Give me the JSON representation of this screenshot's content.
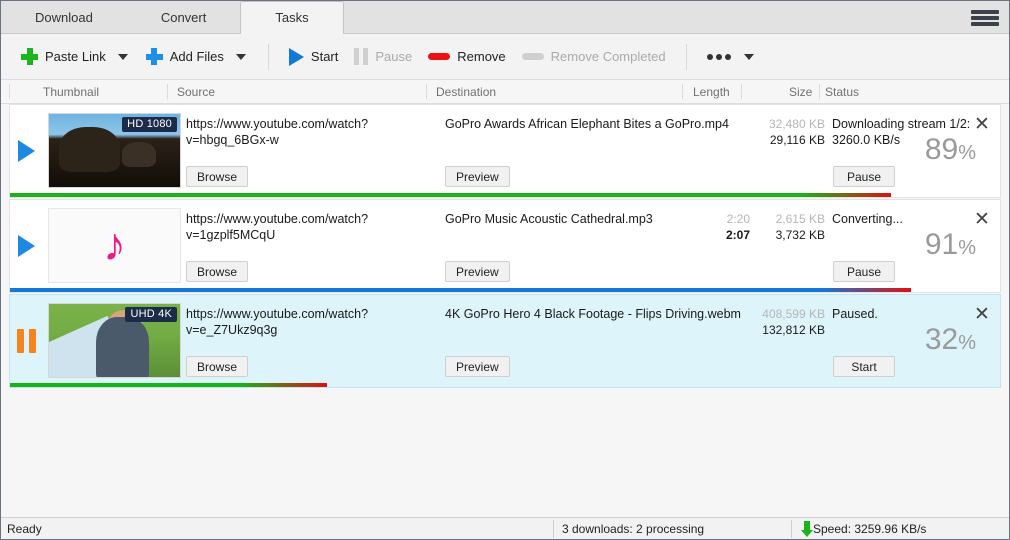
{
  "window": {
    "tabs": [
      {
        "label": "Download",
        "active": false
      },
      {
        "label": "Convert",
        "active": false
      },
      {
        "label": "Tasks",
        "active": true
      }
    ],
    "menu_icon": "hamburger-menu-icon"
  },
  "toolbar": {
    "paste_link": "Paste Link",
    "add_files": "Add Files",
    "start": "Start",
    "pause": "Pause",
    "remove": "Remove",
    "remove_completed": "Remove Completed",
    "more": "more-options-icon",
    "colors": {
      "paste_plus": "#1cb61c",
      "add_plus": "#1e90e8",
      "start_play": "#1479d6",
      "remove_bar": "#ee1111",
      "disabled": "#cfcfcf"
    }
  },
  "columns": {
    "thumbnail": "Thumbnail",
    "source": "Source",
    "destination": "Destination",
    "length": "Length",
    "size": "Size",
    "status": "Status"
  },
  "rows": [
    {
      "state_icon": "play-icon",
      "selected": false,
      "thumbnail": {
        "kind": "video",
        "art": "art-eleph",
        "badge": "HD 1080"
      },
      "source": "https://www.youtube.com/watch?v=hbgq_6BGx-w",
      "destination": "GoPro Awards  African Elephant Bites a GoPro.mp4",
      "length_total": "",
      "length_current": "",
      "size_total": "32,480 KB",
      "size_current": "29,116 KB",
      "status_line1": "Downloading stream 1/2:",
      "status_line2": "3260.0 KB/s",
      "percent": 89,
      "percent_label": "89",
      "browse": "Browse",
      "preview": "Preview",
      "action": "Pause",
      "close": "close-icon",
      "bar_color": "#18b318"
    },
    {
      "state_icon": "play-icon",
      "selected": false,
      "thumbnail": {
        "kind": "audio",
        "art": "",
        "badge": ""
      },
      "source": "https://www.youtube.com/watch?v=1gzplf5MCqU",
      "destination": "GoPro Music  Acoustic Cathedral.mp3",
      "length_total": "2:20",
      "length_current": "2:07",
      "size_total": "2,615 KB",
      "size_current": "3,732 KB",
      "status_line1": "Converting...",
      "status_line2": "",
      "percent": 91,
      "percent_label": "91",
      "browse": "Browse",
      "preview": "Preview",
      "action": "Pause",
      "close": "close-icon",
      "bar_color": "#1479d6"
    },
    {
      "state_icon": "pause-icon",
      "selected": true,
      "thumbnail": {
        "kind": "video",
        "art": "art-sky",
        "badge": "UHD 4K"
      },
      "source": "https://www.youtube.com/watch?v=e_Z7Ukz9q3g",
      "destination": "4K GoPro Hero 4 Black Footage - Flips Driving.webm",
      "length_total": "",
      "length_current": "",
      "size_total": "408,599 KB",
      "size_current": "132,812 KB",
      "status_line1": "Paused.",
      "status_line2": "",
      "percent": 32,
      "percent_label": "32",
      "browse": "Browse",
      "preview": "Preview",
      "action": "Start",
      "close": "close-icon",
      "bar_color": "#18b318"
    }
  ],
  "statusbar": {
    "ready": "Ready",
    "downloads": "3 downloads: 2 processing",
    "speed": "Speed: 3259.96 KB/s",
    "speed_icon": "download-arrow-icon"
  }
}
